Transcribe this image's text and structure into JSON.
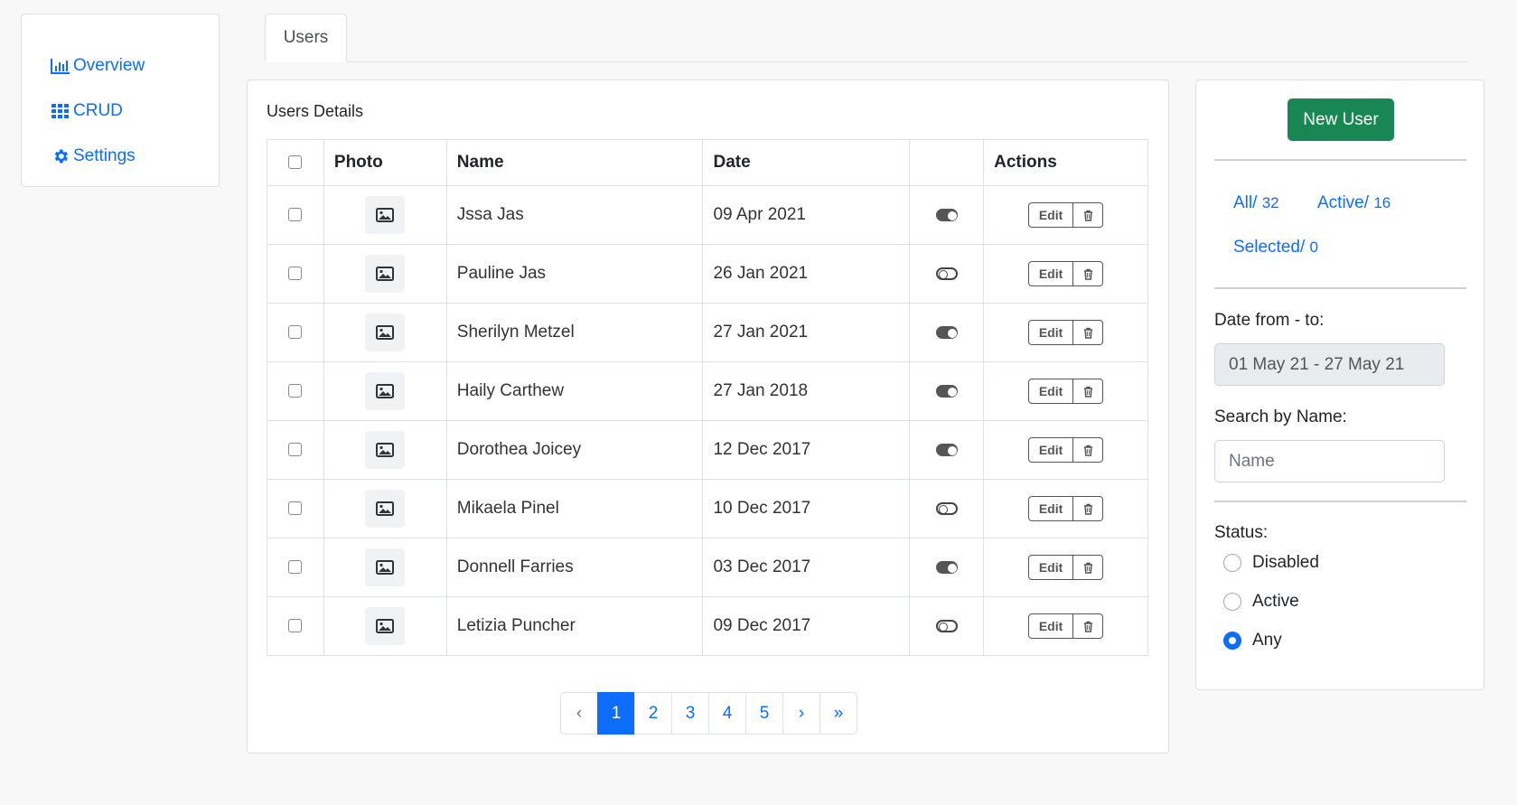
{
  "sidebar": {
    "items": [
      {
        "label": "Overview",
        "icon": "bar-chart-icon"
      },
      {
        "label": "CRUD",
        "icon": "grid-icon"
      },
      {
        "label": "Settings",
        "icon": "gear-icon"
      }
    ]
  },
  "tabs": [
    {
      "label": "Users",
      "active": true
    }
  ],
  "main": {
    "title": "Users Details",
    "columns": [
      "Photo",
      "Name",
      "Date",
      "Actions"
    ],
    "rows": [
      {
        "name": "Jssa Jas",
        "date": "09 Apr 2021",
        "active": true
      },
      {
        "name": "Pauline Jas",
        "date": "26 Jan 2021",
        "active": false
      },
      {
        "name": "Sherilyn Metzel",
        "date": "27 Jan 2021",
        "active": true
      },
      {
        "name": "Haily Carthew",
        "date": "27 Jan 2018",
        "active": true
      },
      {
        "name": "Dorothea Joicey",
        "date": "12 Dec 2017",
        "active": true
      },
      {
        "name": "Mikaela Pinel",
        "date": "10 Dec 2017",
        "active": false
      },
      {
        "name": "Donnell Farries",
        "date": "03 Dec 2017",
        "active": true
      },
      {
        "name": "Letizia Puncher",
        "date": "09 Dec 2017",
        "active": false
      }
    ],
    "edit_label": "Edit",
    "pagination": {
      "prev": "‹",
      "pages": [
        "1",
        "2",
        "3",
        "4",
        "5"
      ],
      "current": "1",
      "next": "›",
      "last": "»"
    }
  },
  "side": {
    "new_user_label": "New User",
    "filters": {
      "all_label": "All/",
      "all_count": "32",
      "active_label": "Active/",
      "active_count": "16",
      "selected_label": "Selected/",
      "selected_count": "0"
    },
    "date_label": "Date from - to:",
    "date_value": "01 May 21 - 27 May 21",
    "search_label": "Search by Name:",
    "search_placeholder": "Name",
    "status_label": "Status:",
    "status_options": [
      "Disabled",
      "Active",
      "Any"
    ],
    "status_selected": "Any"
  },
  "colors": {
    "primary": "#0d6efd",
    "success": "#198754",
    "border": "#dee2e6"
  }
}
